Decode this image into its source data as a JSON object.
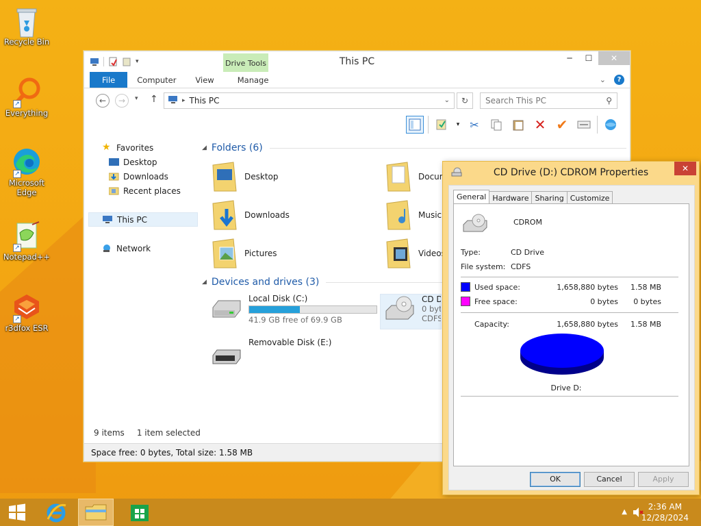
{
  "desktop": {
    "icons": [
      {
        "label": "Recycle Bin"
      },
      {
        "label": "Everything"
      },
      {
        "label": "Microsoft Edge"
      },
      {
        "label": "Notepad++"
      },
      {
        "label": "r3dfox ESR"
      }
    ]
  },
  "explorer": {
    "title": "This PC",
    "context_tab": "Drive Tools",
    "tabs": [
      "File",
      "Computer",
      "View",
      "Manage"
    ],
    "address": "This PC",
    "search_placeholder": "Search This PC",
    "nav": {
      "favorites": "Favorites",
      "favorites_items": [
        "Desktop",
        "Downloads",
        "Recent places"
      ],
      "this_pc": "This PC",
      "network": "Network"
    },
    "folders_header": "Folders (6)",
    "folders": [
      "Desktop",
      "Documents",
      "Downloads",
      "Music",
      "Pictures",
      "Videos"
    ],
    "devices_header": "Devices and drives (3)",
    "drives": [
      {
        "name": "Local Disk (C:)",
        "free": "41.9 GB free of 69.9 GB",
        "used_fraction": 0.4
      },
      {
        "name": "CD Drive (D:) CDROM",
        "free": "0 bytes free of 1.58 MB",
        "fs": "CDFS"
      },
      {
        "name": "Removable Disk (E:)"
      }
    ],
    "status": {
      "items": "9 items",
      "selected": "1 item selected"
    },
    "details_bar": "Space free: 0 bytes, Total size: 1.58 MB"
  },
  "dialog": {
    "title": "CD Drive (D:) CDROM Properties",
    "tabs": [
      "General",
      "Hardware",
      "Sharing",
      "Customize"
    ],
    "label": "CDROM",
    "type_label": "Type:",
    "type_value": "CD Drive",
    "fs_label": "File system:",
    "fs_value": "CDFS",
    "used_label": "Used space:",
    "used_bytes": "1,658,880 bytes",
    "used_size": "1.58 MB",
    "free_label": "Free space:",
    "free_bytes": "0 bytes",
    "free_size": "0 bytes",
    "capacity_label": "Capacity:",
    "capacity_bytes": "1,658,880 bytes",
    "capacity_size": "1.58 MB",
    "drive_label": "Drive D:",
    "buttons": {
      "ok": "OK",
      "cancel": "Cancel",
      "apply": "Apply"
    },
    "colors": {
      "used": "#0000ff",
      "free": "#ff00ff"
    }
  },
  "taskbar": {
    "time": "2:36 AM",
    "date": "12/28/2024"
  }
}
